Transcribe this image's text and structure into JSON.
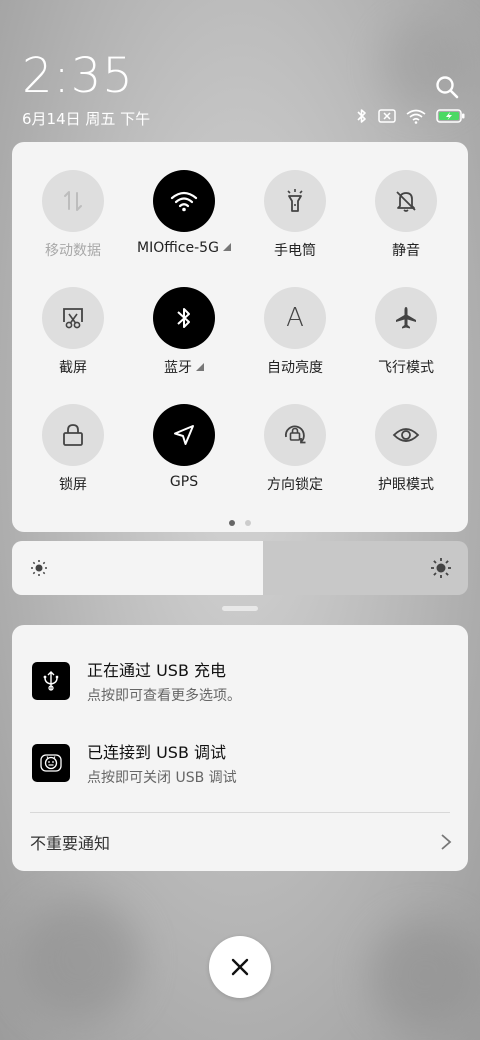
{
  "status": {
    "time": "2:35",
    "date": "6月14日 周五 下午",
    "icons": [
      "search-icon",
      "bluetooth-icon",
      "no-sim-icon",
      "wifi-icon",
      "battery-charging-icon"
    ],
    "battery_color": "#4cd964"
  },
  "quick_settings": {
    "tiles": [
      {
        "label": "移动数据",
        "icon": "mobile-data-icon",
        "on": false,
        "disabled": true
      },
      {
        "label": "MIOffice-5G",
        "icon": "wifi-icon",
        "on": true
      },
      {
        "label": "手电筒",
        "icon": "flashlight-icon",
        "on": false
      },
      {
        "label": "静音",
        "icon": "mute-bell-icon",
        "on": false
      },
      {
        "label": "截屏",
        "icon": "screenshot-icon",
        "on": false
      },
      {
        "label": "蓝牙",
        "icon": "bluetooth-icon",
        "on": true
      },
      {
        "label": "自动亮度",
        "icon": "auto-brightness-icon",
        "on": false
      },
      {
        "label": "飞行模式",
        "icon": "airplane-icon",
        "on": false
      },
      {
        "label": "锁屏",
        "icon": "lock-icon",
        "on": false
      },
      {
        "label": "GPS",
        "icon": "gps-icon",
        "on": true
      },
      {
        "label": "方向锁定",
        "icon": "rotation-lock-icon",
        "on": false
      },
      {
        "label": "护眼模式",
        "icon": "eye-icon",
        "on": false
      }
    ],
    "auto_brightness_letter": "A",
    "page_count": 2,
    "current_page": 1
  },
  "brightness": {
    "level": 0.55
  },
  "notifications": [
    {
      "title": "正在通过 USB 充电",
      "subtitle": "点按即可查看更多选项。",
      "icon": "usb-icon"
    },
    {
      "title": "已连接到 USB 调试",
      "subtitle": "点按即可关闭 USB 调试",
      "icon": "android-debug-icon"
    }
  ],
  "unimportant_label": "不重要通知",
  "clear_icon": "close-icon"
}
